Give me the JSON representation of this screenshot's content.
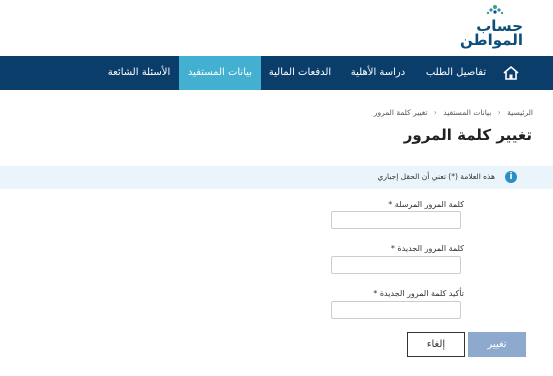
{
  "header": {
    "logo_line1": "حساب",
    "logo_line2": "المواطن"
  },
  "nav": {
    "items": [
      {
        "label": "تفاصيل الطلب"
      },
      {
        "label": "دراسة الأهلية"
      },
      {
        "label": "الدفعات المالية"
      },
      {
        "label": "بيانات المستفيد",
        "active": true
      },
      {
        "label": "الأسئلة الشائعة"
      }
    ]
  },
  "breadcrumb": {
    "home": "الرئيسية",
    "level2": "بيانات المستفيد",
    "current": "تغيير كلمة المرور"
  },
  "page": {
    "title": "تغيير كلمة المرور"
  },
  "notice": {
    "text": "هذه العلامة (*) تعني أن الحقل إجباري"
  },
  "form": {
    "current_password_label": "كلمة المرور المرسلة *",
    "current_password_value": "",
    "new_password_label": "كلمة المرور الجديدة *",
    "new_password_value": "",
    "confirm_password_label": "تأكيد كلمة المرور الجديدة *",
    "confirm_password_value": ""
  },
  "actions": {
    "change_label": "تغيير",
    "cancel_label": "إلغاء"
  },
  "colors": {
    "nav_bg": "#0b3d6b",
    "nav_active": "#43afd1",
    "brand": "#0b4f7a",
    "notice_bg": "#e9f5fb",
    "primary_button": "#8da9cd"
  }
}
